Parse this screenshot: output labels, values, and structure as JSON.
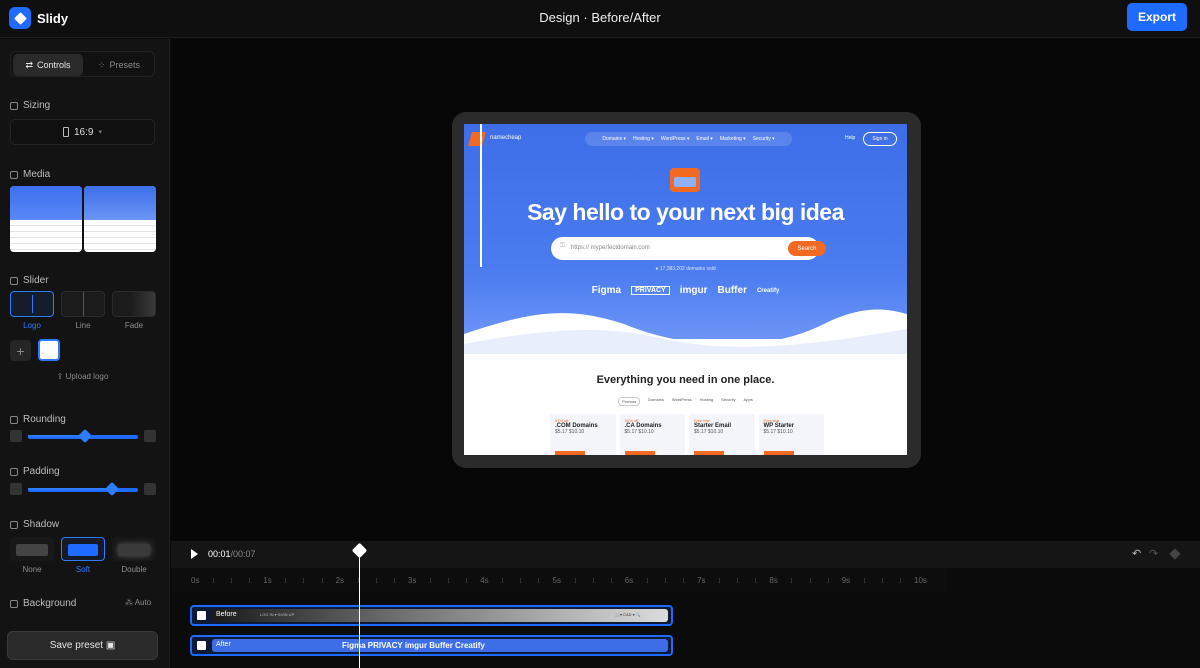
{
  "app": {
    "name": "Slidy",
    "title_prefix": "Design ·",
    "title": "Before/After",
    "export_label": "Export"
  },
  "sidebar": {
    "tabs": [
      {
        "label": "Controls",
        "icon": "sliders-icon",
        "active": true
      },
      {
        "label": "Presets",
        "icon": "presets-icon",
        "active": false
      }
    ],
    "sizing": {
      "title": "Sizing",
      "ratio": "16:9"
    },
    "media": {
      "title": "Media"
    },
    "slider": {
      "title": "Slider",
      "options": [
        "Logo",
        "Line",
        "Fade"
      ],
      "selected": "Logo",
      "upload_label": "Upload logo"
    },
    "rounding": {
      "title": "Rounding",
      "value": 0.5
    },
    "padding": {
      "title": "Padding",
      "value": 0.75
    },
    "shadow": {
      "title": "Shadow",
      "options": [
        "None",
        "Soft",
        "Double"
      ],
      "selected": "Soft"
    },
    "background": {
      "title": "Background",
      "mode": "Auto"
    },
    "save_label": "Save preset"
  },
  "preview": {
    "brand": "namecheap",
    "nav_links": [
      "Domains ▾",
      "Hosting ▾",
      "WordPress ▾",
      "Email ▾",
      "Marketing ▾",
      "Security ▾"
    ],
    "help": "Help",
    "signin": "Sign in",
    "headline": "Say hello to your next big idea",
    "search_placeholder": "https:// myperfectdomain.com",
    "search_button": "Search",
    "sold": "● 17,383,202 domains sold",
    "brands": [
      "Figma",
      "PRIVACY",
      "imgur",
      "Buffer",
      "Creatify"
    ],
    "everything": "Everything you need in one place.",
    "tabs": [
      "Promos",
      "Domains",
      "WordPress",
      "Hosting",
      "Security",
      "Apps"
    ],
    "cards": [
      {
        "tag": "57% off",
        "name": ".COM Domains",
        "price": "$5.17 $10.10"
      },
      {
        "tag": "30% off",
        "name": ".CA Domains",
        "price": "$5.17 $10.10"
      },
      {
        "tag": "Free trial",
        "name": "Starter Email",
        "price": "$5.17 $10.10"
      },
      {
        "tag": "Free trial",
        "name": "WP Starter",
        "price": "$5.17 $10.10"
      }
    ]
  },
  "timeline": {
    "current": "00:01",
    "total": "/00:07",
    "ticks": [
      "0s",
      "1s",
      "2s",
      "3s",
      "4s",
      "5s",
      "6s",
      "7s",
      "8s",
      "9s",
      "10s"
    ],
    "tracks": [
      {
        "label": "Before"
      },
      {
        "label": "After"
      }
    ],
    "after_strip_text": "Figma  PRIVACY  imgur  Buffer  Creatify",
    "before_strip_text": "LOG IN ▾   SIGN UP",
    "before_strip_right": "🛒▾  CAD ▾  🔍",
    "playhead_time": 1.0
  }
}
